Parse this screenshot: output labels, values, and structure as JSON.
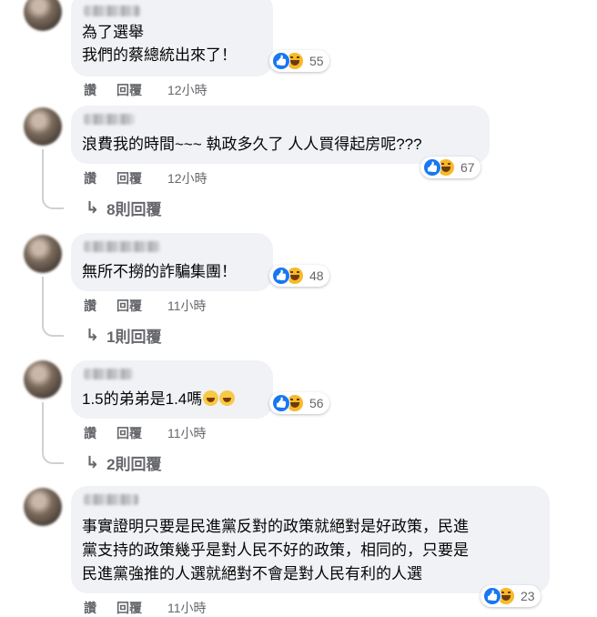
{
  "actions": {
    "like": "讚",
    "reply": "回覆"
  },
  "comments": [
    {
      "lines": [
        "為了選舉",
        "我們的蔡總統出來了！"
      ],
      "reactions": 55,
      "time": "12小時",
      "replies": ""
    },
    {
      "lines": [
        "浪費我的時間~~~ 執政多久了 人人買得起房呢???"
      ],
      "reactions": 67,
      "time": "12小時",
      "replies": "8則回覆"
    },
    {
      "lines": [
        "無所不撈的詐騙集團！"
      ],
      "reactions": 48,
      "time": "11小時",
      "replies": "1則回覆"
    },
    {
      "lines": [
        "1.5的弟弟是1.4嗎"
      ],
      "reactions": 56,
      "time": "11小時",
      "replies": "2則回覆"
    },
    {
      "lines": [
        "事實證明只要是民進黨反對的政策就絕對是好政策，民進",
        "黨支持的政策幾乎是對人民不好的政策，相同的，只要是",
        "民進黨強推的人選就絕對不會是對人民有利的人選"
      ],
      "reactions": 23,
      "time": "11小時",
      "replies": ""
    }
  ],
  "colors": {
    "bubble": "#f0f2f5",
    "meta": "#65676b",
    "like": "#1877f2",
    "haha": "#f7b928"
  },
  "icons": {
    "like": "like-reaction-icon",
    "haha": "haha-reaction-icon",
    "reply_arrow": "reply-arrow-icon"
  }
}
